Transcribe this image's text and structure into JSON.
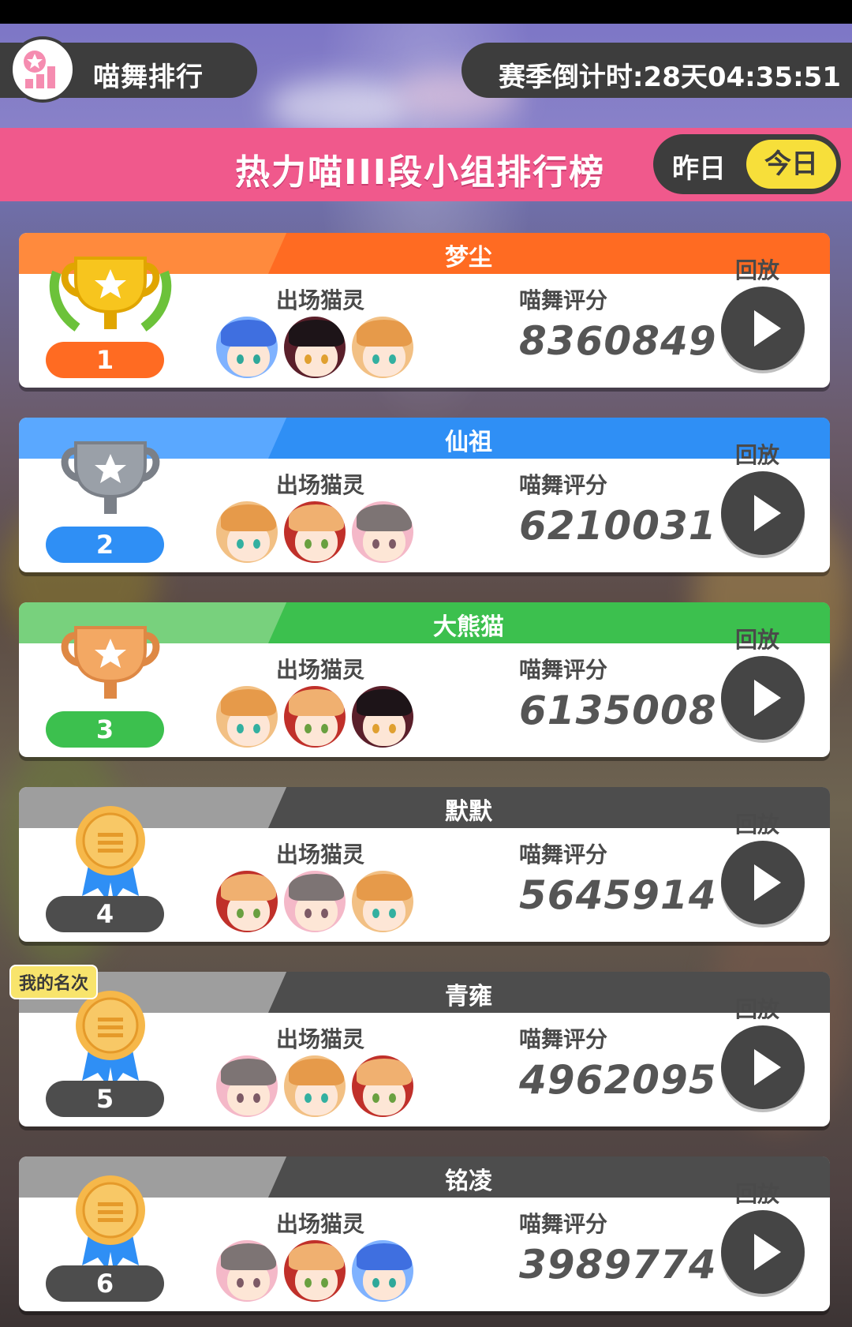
{
  "header": {
    "title": "喵舞排行",
    "countdown_label": "赛季倒计时:",
    "countdown_value": "28天04:35:51"
  },
  "board": {
    "title": "热力喵III段小组排行榜",
    "tab_yesterday": "昨日",
    "tab_today": "今日",
    "selected_tab": "今日"
  },
  "labels": {
    "cats": "出场猫灵",
    "score": "喵舞评分",
    "replay": "回放",
    "my_rank": "我的名次"
  },
  "colors": {
    "gold": "#ff6b22",
    "silver": "#2f8ff5",
    "bronze": "#3cc04e",
    "other": "#4d4d4d",
    "pink": "#f0598c",
    "yellow": "#f7df3a"
  },
  "entries": [
    {
      "rank": "1",
      "name": "梦尘",
      "score": "8360849",
      "avatars": [
        "blue-hair-cat-spirit",
        "black-hair-cat-spirit",
        "orange-hair-cat-spirit"
      ]
    },
    {
      "rank": "2",
      "name": "仙祖",
      "score": "6210031",
      "avatars": [
        "orange-hair-cat-spirit",
        "red-hood-cat-spirit",
        "gray-hair-cat-spirit"
      ]
    },
    {
      "rank": "3",
      "name": "大熊猫",
      "score": "6135008",
      "avatars": [
        "orange-hair-cat-spirit",
        "red-hood-cat-spirit",
        "black-hair-cat-spirit"
      ]
    },
    {
      "rank": "4",
      "name": "默默",
      "score": "5645914",
      "avatars": [
        "red-hood-cat-spirit",
        "gray-hair-cat-spirit",
        "orange-hair-cat-spirit"
      ]
    },
    {
      "rank": "5",
      "name": "青雍",
      "score": "4962095",
      "avatars": [
        "gray-hair-cat-spirit",
        "orange-hair-cat-spirit",
        "red-hood-cat-spirit"
      ]
    },
    {
      "rank": "6",
      "name": "铭凌",
      "score": "3989774",
      "avatars": [
        "gray-hair-cat-spirit",
        "red-hood-cat-spirit",
        "blue-hair-cat-spirit"
      ]
    }
  ]
}
